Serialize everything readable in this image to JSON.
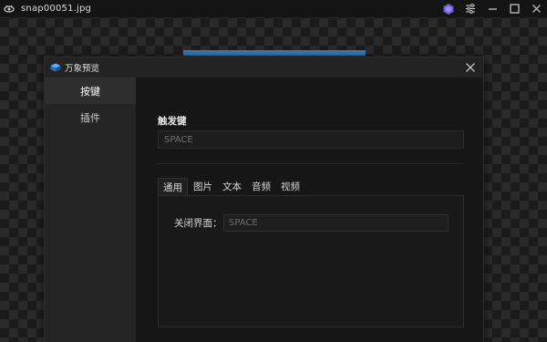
{
  "window": {
    "file_name": "snap00051.jpg",
    "app_icon": "eye-icon",
    "badge_icon": "hex-badge-icon",
    "controls": [
      "settings-sliders-icon",
      "minimize-icon",
      "maximize-icon",
      "close-icon"
    ]
  },
  "dialog": {
    "title": "万象预览",
    "title_icon": "cube-logo-icon",
    "close_icon": "close-icon",
    "sidebar": {
      "items": [
        {
          "label": "按键",
          "active": true
        },
        {
          "label": "插件",
          "active": false
        }
      ]
    },
    "trigger": {
      "label": "触发键",
      "value": "SPACE"
    },
    "tabs": [
      {
        "label": "通用",
        "active": true
      },
      {
        "label": "图片",
        "active": false
      },
      {
        "label": "文本",
        "active": false
      },
      {
        "label": "音频",
        "active": false
      },
      {
        "label": "视频",
        "active": false
      }
    ],
    "general": {
      "close_label": "关闭界面：",
      "close_value": "SPACE"
    }
  },
  "colors": {
    "accent": "#3d7bb6",
    "dialog_bg": "#1c1c1c",
    "sidebar_bg": "#242424"
  }
}
